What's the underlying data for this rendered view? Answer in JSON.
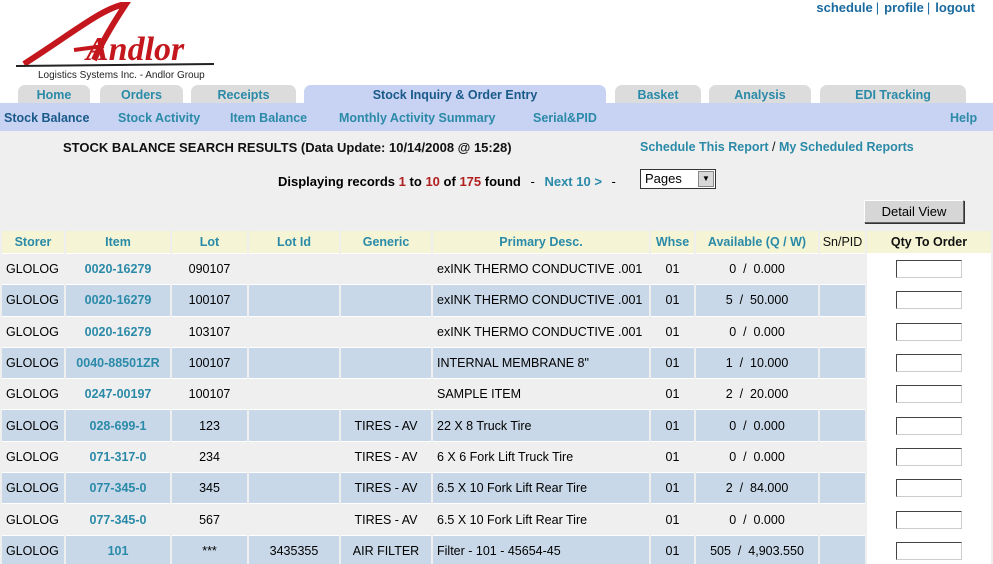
{
  "top_links": {
    "schedule": "schedule",
    "profile": "profile",
    "logout": "logout",
    "separator": "|"
  },
  "logo": {
    "name": "Andlor",
    "tagline": "Logistics Systems Inc. - Andlor Group"
  },
  "tabs": [
    {
      "label": "Home"
    },
    {
      "label": "Orders"
    },
    {
      "label": "Receipts"
    },
    {
      "label": "Stock Inquiry & Order Entry"
    },
    {
      "label": "Basket"
    },
    {
      "label": "Analysis"
    },
    {
      "label": "EDI Tracking"
    }
  ],
  "subnav": {
    "items": [
      {
        "label": "Stock Balance"
      },
      {
        "label": "Stock Activity"
      },
      {
        "label": "Item Balance"
      },
      {
        "label": "Monthly Activity Summary"
      },
      {
        "label": "Serial&PID"
      }
    ],
    "help": "Help"
  },
  "report": {
    "title": "STOCK BALANCE SEARCH RESULTS (Data Update: 10/14/2008 @ 15:28)",
    "schedule_link": "Schedule This Report",
    "slash": "/",
    "my_scheduled_link": "My Scheduled Reports"
  },
  "paging": {
    "prefix": "Displaying records",
    "from": "1",
    "to_word": "to",
    "to": "10",
    "of_word": "of",
    "total": "175",
    "found": "found",
    "dash": "-",
    "next": "Next 10 >",
    "pages_select": "Pages"
  },
  "detail_view": "Detail View",
  "table": {
    "headers": [
      "Storer",
      "Item",
      "Lot",
      "Lot Id",
      "Generic",
      "Primary Desc.",
      "Whse",
      "Available (Q / W)",
      "Sn/PID",
      "Qty To Order"
    ],
    "rows": [
      {
        "storer": "GLOLOG",
        "item": "0020-16279",
        "lot": "090107",
        "lot_id": "",
        "generic": "",
        "desc": "exINK THERMO CONDUCTIVE .001",
        "whse": "01",
        "available": "0  /  0.000",
        "snpid": ""
      },
      {
        "storer": "GLOLOG",
        "item": "0020-16279",
        "lot": "100107",
        "lot_id": "",
        "generic": "",
        "desc": "exINK THERMO CONDUCTIVE .001",
        "whse": "01",
        "available": "5  /  50.000",
        "snpid": ""
      },
      {
        "storer": "GLOLOG",
        "item": "0020-16279",
        "lot": "103107",
        "lot_id": "",
        "generic": "",
        "desc": "exINK THERMO CONDUCTIVE .001",
        "whse": "01",
        "available": "0  /  0.000",
        "snpid": ""
      },
      {
        "storer": "GLOLOG",
        "item": "0040-88501ZR",
        "lot": "100107",
        "lot_id": "",
        "generic": "",
        "desc": "INTERNAL MEMBRANE 8\"",
        "whse": "01",
        "available": "1  /  10.000",
        "snpid": ""
      },
      {
        "storer": "GLOLOG",
        "item": "0247-00197",
        "lot": "100107",
        "lot_id": "",
        "generic": "",
        "desc": "SAMPLE ITEM",
        "whse": "01",
        "available": "2  /  20.000",
        "snpid": ""
      },
      {
        "storer": "GLOLOG",
        "item": "028-699-1",
        "lot": "123",
        "lot_id": "",
        "generic": "TIRES - AV",
        "desc": "22 X 8 Truck Tire",
        "whse": "01",
        "available": "0  /  0.000",
        "snpid": ""
      },
      {
        "storer": "GLOLOG",
        "item": "071-317-0",
        "lot": "234",
        "lot_id": "",
        "generic": "TIRES - AV",
        "desc": "6 X 6 Fork Lift Truck Tire",
        "whse": "01",
        "available": "0  /  0.000",
        "snpid": ""
      },
      {
        "storer": "GLOLOG",
        "item": "077-345-0",
        "lot": "345",
        "lot_id": "",
        "generic": "TIRES - AV",
        "desc": "6.5 X 10 Fork Lift Rear Tire",
        "whse": "01",
        "available": "2  /  84.000",
        "snpid": ""
      },
      {
        "storer": "GLOLOG",
        "item": "077-345-0",
        "lot": "567",
        "lot_id": "",
        "generic": "TIRES - AV",
        "desc": "6.5 X 10 Fork Lift Rear Tire",
        "whse": "01",
        "available": "0  /  0.000",
        "snpid": ""
      },
      {
        "storer": "GLOLOG",
        "item": "101",
        "lot": "***",
        "lot_id": "3435355",
        "generic": "AIR FILTER",
        "desc": "Filter - 101 - 45654-45",
        "whse": "01",
        "available": "505  /  4,903.550",
        "snpid": ""
      }
    ]
  },
  "colors": {
    "accent": "#2a8aa8",
    "nav_bg": "#c8d2f2",
    "row_alt": "#c8d8e8",
    "header_bg": "#f5f5d5",
    "logo_red": "#c4171d"
  }
}
